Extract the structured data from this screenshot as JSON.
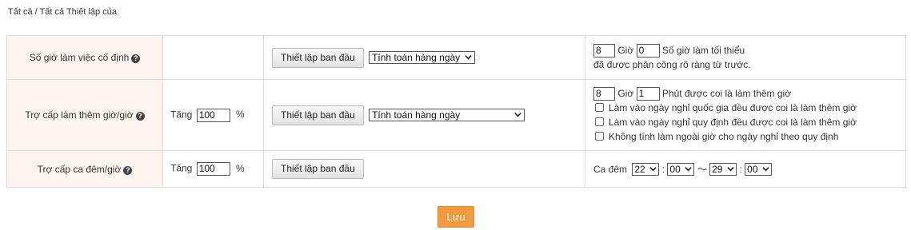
{
  "breadcrumb": "Tất cả / Tất cả Thiết lập của",
  "rows": {
    "fixed_hours": {
      "label": "Số giờ làm việc cố định",
      "init_button": "Thiết lập ban đầu",
      "calc_select": "Tính toán hàng ngày",
      "hours_value": "8",
      "hours_unit": "Giờ",
      "minutes_value": "0",
      "min_hours_text": "Số giờ làm tối thiểu",
      "assigned_text": "đã được phân công rõ ràng từ trước."
    },
    "overtime": {
      "label": "Trợ cấp làm thêm giờ/giờ",
      "rate_prefix": "Tăng",
      "rate_value": "100",
      "rate_suffix": "%",
      "init_button": "Thiết lập ban đầu",
      "calc_select": "Tính toán hàng ngày",
      "hours_value": "8",
      "hours_unit": "Giờ",
      "minutes_value": "1",
      "overtime_text": "Phút được coi là làm thêm giờ",
      "checkboxes": [
        {
          "label": "Làm vào ngày nghỉ quốc gia đều được coi là làm thêm giờ",
          "checked": false
        },
        {
          "label": "Làm vào ngày nghỉ quy định đều được coi là làm thêm giờ",
          "checked": false
        },
        {
          "label": "Không tính làm ngoài giờ cho ngày nghỉ theo quy định",
          "checked": false
        }
      ]
    },
    "night_shift": {
      "label": "Trợ cấp ca đêm/giờ",
      "rate_prefix": "Tăng",
      "rate_value": "100",
      "rate_suffix": "%",
      "init_button": "Thiết lập ban đầu",
      "shift_label": "Ca đêm",
      "start_hour": "22",
      "start_minute": "00",
      "range_sep": "〜",
      "end_hour": "29",
      "end_minute": "00",
      "colon": ":"
    }
  },
  "help_icon": "?",
  "save_label": "Lưu",
  "colors": {
    "label_bg": "#fdf4ef",
    "save_bg": "#f29a3d",
    "border": "#dddddd"
  }
}
